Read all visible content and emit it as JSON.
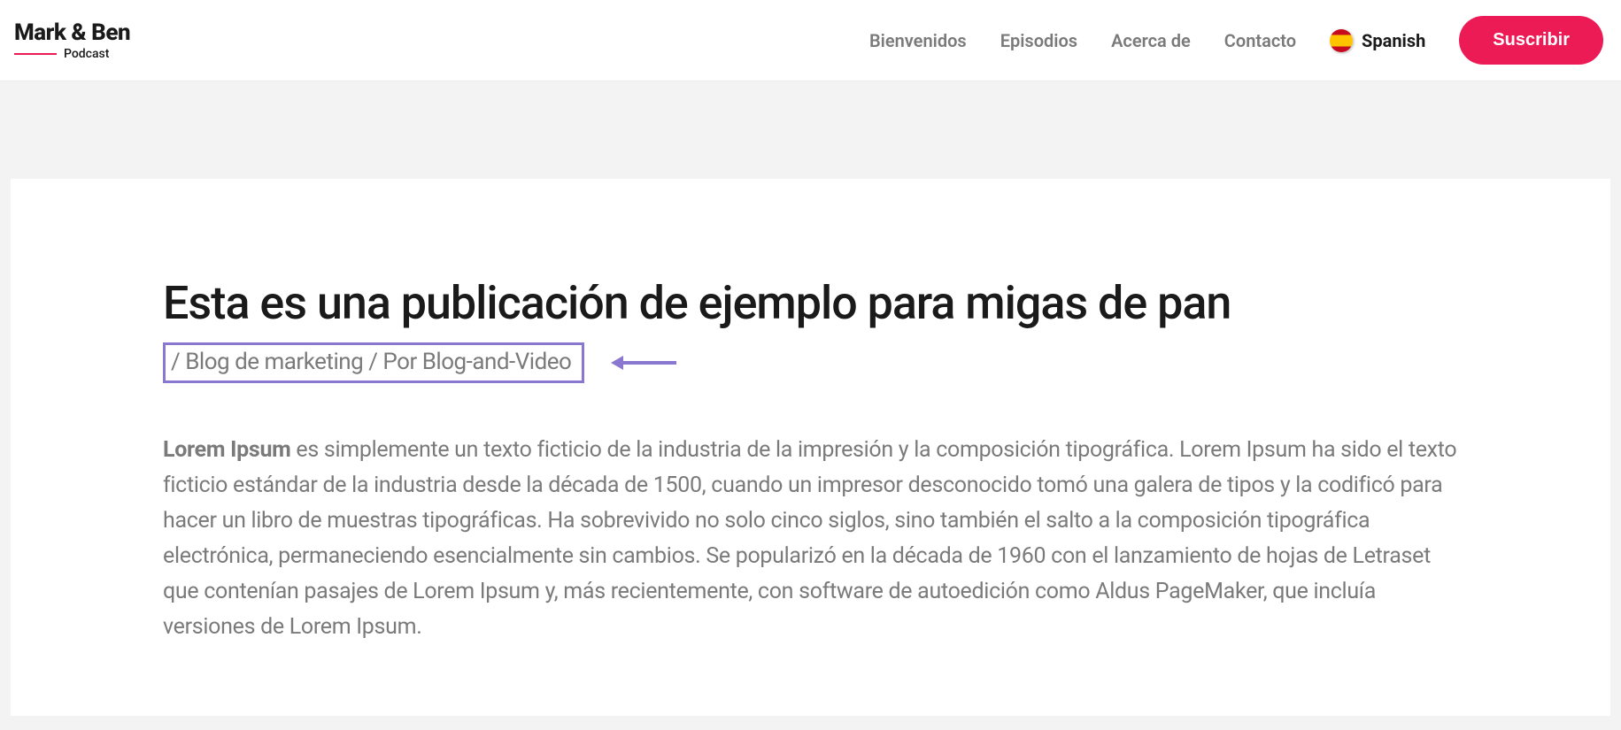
{
  "logo": {
    "main": "Mark & Ben",
    "sub": "Podcast"
  },
  "nav": {
    "items": [
      "Bienvenidos",
      "Episodios",
      "Acerca de",
      "Contacto"
    ]
  },
  "lang": {
    "label": "Spanish"
  },
  "subscribe": {
    "label": "Suscribir"
  },
  "post": {
    "title": "Esta es una publicación de ejemplo para migas de pan",
    "breadcrumb": {
      "sep1": "/ ",
      "category": "Blog de marketing",
      "sep2": " / Por ",
      "author": "Blog-and-Video"
    },
    "body_strong": "Lorem Ipsum",
    "body_rest": " es simplemente un texto ficticio de la industria de la impresión y la composición tipográfica. Lorem Ipsum ha sido el texto ficticio estándar de la industria desde la década de 1500, cuando un impresor desconocido tomó una galera de tipos y la codificó para hacer un libro de muestras tipográficas. Ha sobrevivido no solo cinco siglos, sino también el salto a la composición tipográfica electrónica, permaneciendo esencialmente sin cambios. Se popularizó en la década de 1960 con el lanzamiento de hojas de Letraset que contenían pasajes de Lorem Ipsum y, más recientemente, con software de autoedición como Aldus PageMaker, que incluía versiones de Lorem Ipsum."
  }
}
